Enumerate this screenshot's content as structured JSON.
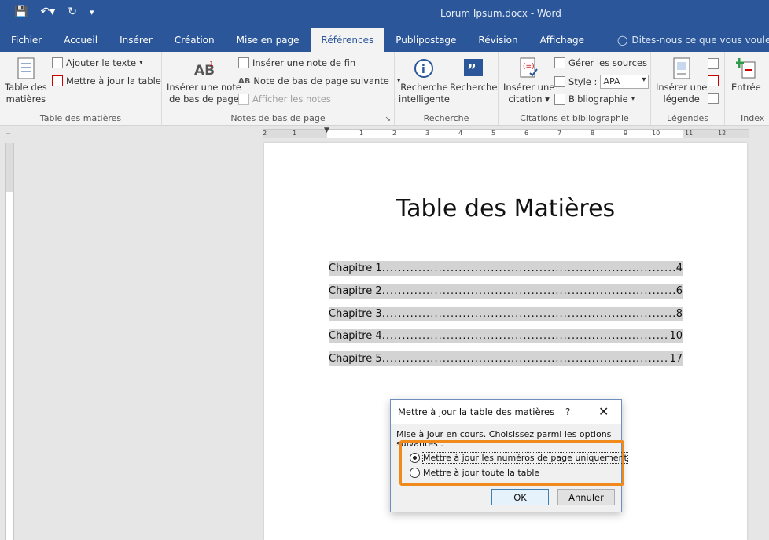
{
  "window": {
    "title": "Lorum Ipsum.docx  -  Word"
  },
  "qat": {
    "save_icon": "save-icon",
    "undo_icon": "undo-icon",
    "redo_icon": "redo-icon",
    "customize_icon": "customize-icon"
  },
  "tabs": [
    {
      "label": "Fichier"
    },
    {
      "label": "Accueil"
    },
    {
      "label": "Insérer"
    },
    {
      "label": "Création"
    },
    {
      "label": "Mise en page"
    },
    {
      "label": "Références",
      "active": true
    },
    {
      "label": "Publipostage"
    },
    {
      "label": "Révision"
    },
    {
      "label": "Affichage"
    }
  ],
  "tell_me": "Dites-nous ce que vous voulez faire",
  "ribbon": {
    "toc_group": {
      "label": "Table des matières",
      "table_btn": "Table des",
      "table_btn2": "matières",
      "add_text": "Ajouter le texte",
      "update_table": "Mettre à jour la table"
    },
    "footnotes_group": {
      "label": "Notes de bas de page",
      "insert_note_btn": "Insérer une note",
      "insert_note_btn2": "de bas de page",
      "insert_endnote": "Insérer une note de fin",
      "next_footnote": "Note de bas de page suivante",
      "show_notes": "Afficher les notes"
    },
    "research_group": {
      "label": "Recherche",
      "smart_btn": "Recherche",
      "smart_btn2": "intelligente",
      "research_btn": "Recherche"
    },
    "citations_group": {
      "label": "Citations et bibliographie",
      "insert_citation": "Insérer une",
      "insert_citation2": "citation",
      "manage_sources": "Gérer les sources",
      "style_label": "Style :",
      "style_value": "APA",
      "bibliography": "Bibliographie"
    },
    "captions_group": {
      "label": "Légendes",
      "insert_caption": "Insérer une",
      "insert_caption2": "légende"
    },
    "index_group": {
      "label": "Index",
      "entry_btn": "Entrée"
    }
  },
  "hruler": {
    "labels": [
      "2",
      "1",
      "1",
      "2",
      "3",
      "4",
      "5",
      "6",
      "7",
      "8",
      "9",
      "10",
      "11",
      "12"
    ]
  },
  "document": {
    "toc_title": "Table des Matières",
    "toc_entries": [
      {
        "label": "Chapitre 1",
        "page": "4"
      },
      {
        "label": "Chapitre 2",
        "page": "6"
      },
      {
        "label": "Chapitre 3",
        "page": "8"
      },
      {
        "label": "Chapitre 4",
        "page": "10"
      },
      {
        "label": "Chapitre 5",
        "page": "17"
      }
    ]
  },
  "dialog": {
    "title": "Mettre à jour la table des matières",
    "help": "?",
    "close": "✕",
    "message": "Mise à jour en cours. Choisissez parmi les options suivantes :",
    "option_pages": "Mettre à jour les numéros de page uniquement",
    "option_table": "Mettre à jour toute la table",
    "ok": "OK",
    "cancel": "Annuler",
    "selected": "option_pages"
  },
  "colors": {
    "accent": "#2b579a",
    "highlight": "#f08a1c"
  }
}
